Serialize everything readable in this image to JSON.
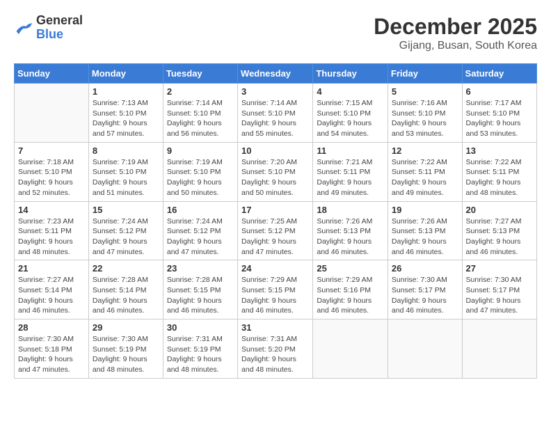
{
  "header": {
    "logo_general": "General",
    "logo_blue": "Blue",
    "month_year": "December 2025",
    "location": "Gijang, Busan, South Korea"
  },
  "days_of_week": [
    "Sunday",
    "Monday",
    "Tuesday",
    "Wednesday",
    "Thursday",
    "Friday",
    "Saturday"
  ],
  "weeks": [
    [
      {
        "day": "",
        "sunrise": "",
        "sunset": "",
        "daylight": ""
      },
      {
        "day": "1",
        "sunrise": "Sunrise: 7:13 AM",
        "sunset": "Sunset: 5:10 PM",
        "daylight": "Daylight: 9 hours and 57 minutes."
      },
      {
        "day": "2",
        "sunrise": "Sunrise: 7:14 AM",
        "sunset": "Sunset: 5:10 PM",
        "daylight": "Daylight: 9 hours and 56 minutes."
      },
      {
        "day": "3",
        "sunrise": "Sunrise: 7:14 AM",
        "sunset": "Sunset: 5:10 PM",
        "daylight": "Daylight: 9 hours and 55 minutes."
      },
      {
        "day": "4",
        "sunrise": "Sunrise: 7:15 AM",
        "sunset": "Sunset: 5:10 PM",
        "daylight": "Daylight: 9 hours and 54 minutes."
      },
      {
        "day": "5",
        "sunrise": "Sunrise: 7:16 AM",
        "sunset": "Sunset: 5:10 PM",
        "daylight": "Daylight: 9 hours and 53 minutes."
      },
      {
        "day": "6",
        "sunrise": "Sunrise: 7:17 AM",
        "sunset": "Sunset: 5:10 PM",
        "daylight": "Daylight: 9 hours and 53 minutes."
      }
    ],
    [
      {
        "day": "7",
        "sunrise": "Sunrise: 7:18 AM",
        "sunset": "Sunset: 5:10 PM",
        "daylight": "Daylight: 9 hours and 52 minutes."
      },
      {
        "day": "8",
        "sunrise": "Sunrise: 7:19 AM",
        "sunset": "Sunset: 5:10 PM",
        "daylight": "Daylight: 9 hours and 51 minutes."
      },
      {
        "day": "9",
        "sunrise": "Sunrise: 7:19 AM",
        "sunset": "Sunset: 5:10 PM",
        "daylight": "Daylight: 9 hours and 50 minutes."
      },
      {
        "day": "10",
        "sunrise": "Sunrise: 7:20 AM",
        "sunset": "Sunset: 5:10 PM",
        "daylight": "Daylight: 9 hours and 50 minutes."
      },
      {
        "day": "11",
        "sunrise": "Sunrise: 7:21 AM",
        "sunset": "Sunset: 5:11 PM",
        "daylight": "Daylight: 9 hours and 49 minutes."
      },
      {
        "day": "12",
        "sunrise": "Sunrise: 7:22 AM",
        "sunset": "Sunset: 5:11 PM",
        "daylight": "Daylight: 9 hours and 49 minutes."
      },
      {
        "day": "13",
        "sunrise": "Sunrise: 7:22 AM",
        "sunset": "Sunset: 5:11 PM",
        "daylight": "Daylight: 9 hours and 48 minutes."
      }
    ],
    [
      {
        "day": "14",
        "sunrise": "Sunrise: 7:23 AM",
        "sunset": "Sunset: 5:11 PM",
        "daylight": "Daylight: 9 hours and 48 minutes."
      },
      {
        "day": "15",
        "sunrise": "Sunrise: 7:24 AM",
        "sunset": "Sunset: 5:12 PM",
        "daylight": "Daylight: 9 hours and 47 minutes."
      },
      {
        "day": "16",
        "sunrise": "Sunrise: 7:24 AM",
        "sunset": "Sunset: 5:12 PM",
        "daylight": "Daylight: 9 hours and 47 minutes."
      },
      {
        "day": "17",
        "sunrise": "Sunrise: 7:25 AM",
        "sunset": "Sunset: 5:12 PM",
        "daylight": "Daylight: 9 hours and 47 minutes."
      },
      {
        "day": "18",
        "sunrise": "Sunrise: 7:26 AM",
        "sunset": "Sunset: 5:13 PM",
        "daylight": "Daylight: 9 hours and 46 minutes."
      },
      {
        "day": "19",
        "sunrise": "Sunrise: 7:26 AM",
        "sunset": "Sunset: 5:13 PM",
        "daylight": "Daylight: 9 hours and 46 minutes."
      },
      {
        "day": "20",
        "sunrise": "Sunrise: 7:27 AM",
        "sunset": "Sunset: 5:13 PM",
        "daylight": "Daylight: 9 hours and 46 minutes."
      }
    ],
    [
      {
        "day": "21",
        "sunrise": "Sunrise: 7:27 AM",
        "sunset": "Sunset: 5:14 PM",
        "daylight": "Daylight: 9 hours and 46 minutes."
      },
      {
        "day": "22",
        "sunrise": "Sunrise: 7:28 AM",
        "sunset": "Sunset: 5:14 PM",
        "daylight": "Daylight: 9 hours and 46 minutes."
      },
      {
        "day": "23",
        "sunrise": "Sunrise: 7:28 AM",
        "sunset": "Sunset: 5:15 PM",
        "daylight": "Daylight: 9 hours and 46 minutes."
      },
      {
        "day": "24",
        "sunrise": "Sunrise: 7:29 AM",
        "sunset": "Sunset: 5:15 PM",
        "daylight": "Daylight: 9 hours and 46 minutes."
      },
      {
        "day": "25",
        "sunrise": "Sunrise: 7:29 AM",
        "sunset": "Sunset: 5:16 PM",
        "daylight": "Daylight: 9 hours and 46 minutes."
      },
      {
        "day": "26",
        "sunrise": "Sunrise: 7:30 AM",
        "sunset": "Sunset: 5:17 PM",
        "daylight": "Daylight: 9 hours and 46 minutes."
      },
      {
        "day": "27",
        "sunrise": "Sunrise: 7:30 AM",
        "sunset": "Sunset: 5:17 PM",
        "daylight": "Daylight: 9 hours and 47 minutes."
      }
    ],
    [
      {
        "day": "28",
        "sunrise": "Sunrise: 7:30 AM",
        "sunset": "Sunset: 5:18 PM",
        "daylight": "Daylight: 9 hours and 47 minutes."
      },
      {
        "day": "29",
        "sunrise": "Sunrise: 7:30 AM",
        "sunset": "Sunset: 5:19 PM",
        "daylight": "Daylight: 9 hours and 48 minutes."
      },
      {
        "day": "30",
        "sunrise": "Sunrise: 7:31 AM",
        "sunset": "Sunset: 5:19 PM",
        "daylight": "Daylight: 9 hours and 48 minutes."
      },
      {
        "day": "31",
        "sunrise": "Sunrise: 7:31 AM",
        "sunset": "Sunset: 5:20 PM",
        "daylight": "Daylight: 9 hours and 48 minutes."
      },
      {
        "day": "",
        "sunrise": "",
        "sunset": "",
        "daylight": ""
      },
      {
        "day": "",
        "sunrise": "",
        "sunset": "",
        "daylight": ""
      },
      {
        "day": "",
        "sunrise": "",
        "sunset": "",
        "daylight": ""
      }
    ]
  ]
}
